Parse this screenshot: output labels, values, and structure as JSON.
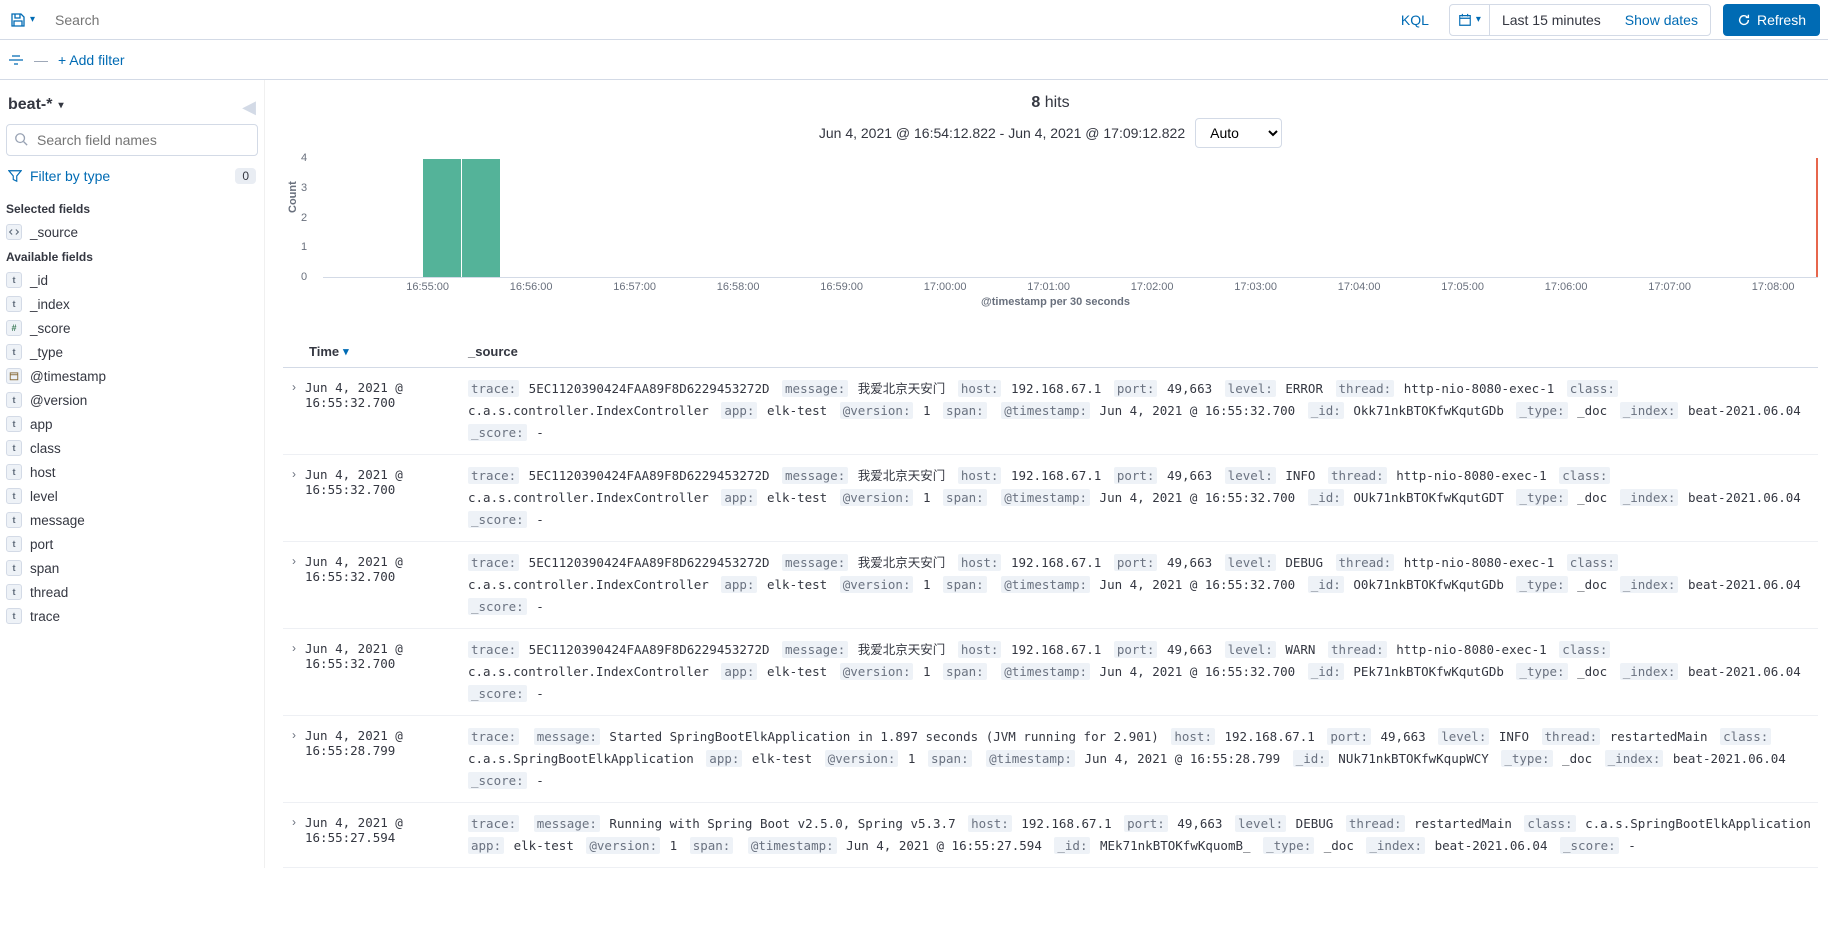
{
  "topbar": {
    "search_placeholder": "Search",
    "kql_label": "KQL",
    "date_text": "Last 15 minutes",
    "show_dates": "Show dates",
    "refresh": "Refresh"
  },
  "filterbar": {
    "add_filter": "+ Add filter"
  },
  "sidebar": {
    "index_pattern": "beat-*",
    "field_search_placeholder": "Search field names",
    "filter_by_type": "Filter by type",
    "filter_count": "0",
    "selected_label": "Selected fields",
    "selected_fields": [
      {
        "type": "src",
        "name": "_source"
      }
    ],
    "available_label": "Available fields",
    "available_fields": [
      {
        "type": "t",
        "name": "_id"
      },
      {
        "type": "t",
        "name": "_index"
      },
      {
        "type": "#",
        "name": "_score"
      },
      {
        "type": "t",
        "name": "_type"
      },
      {
        "type": "d",
        "name": "@timestamp"
      },
      {
        "type": "t",
        "name": "@version"
      },
      {
        "type": "t",
        "name": "app"
      },
      {
        "type": "t",
        "name": "class"
      },
      {
        "type": "t",
        "name": "host"
      },
      {
        "type": "t",
        "name": "level"
      },
      {
        "type": "t",
        "name": "message"
      },
      {
        "type": "t",
        "name": "port"
      },
      {
        "type": "t",
        "name": "span"
      },
      {
        "type": "t",
        "name": "thread"
      },
      {
        "type": "t",
        "name": "trace"
      }
    ]
  },
  "content": {
    "hits_count": "8",
    "hits_label": "hits",
    "time_range": "Jun 4, 2021 @ 16:54:12.822 - Jun 4, 2021 @ 17:09:12.822",
    "interval": "Auto",
    "y_axis_label": "Count",
    "x_axis_label": "@timestamp per 30 seconds",
    "table_headers": {
      "time": "Time",
      "source": "_source"
    }
  },
  "chart_data": {
    "type": "bar",
    "categories": [
      "16:55:00",
      "16:55:30"
    ],
    "values": [
      4,
      4
    ],
    "ylim": [
      0,
      4
    ],
    "y_ticks": [
      0,
      1,
      2,
      3,
      4
    ],
    "x_ticks": [
      "16:55:00",
      "16:56:00",
      "16:57:00",
      "16:58:00",
      "16:59:00",
      "17:00:00",
      "17:01:00",
      "17:02:00",
      "17:03:00",
      "17:04:00",
      "17:05:00",
      "17:06:00",
      "17:07:00",
      "17:08:00"
    ],
    "xlabel": "@timestamp per 30 seconds",
    "ylabel": "Count"
  },
  "documents": [
    {
      "time": "Jun 4, 2021 @ 16:55:32.700",
      "fields": [
        {
          "k": "trace:",
          "v": "5EC1120390424FAA89F8D6229453272D"
        },
        {
          "k": "message:",
          "v": "我爱北京天安门"
        },
        {
          "k": "host:",
          "v": "192.168.67.1"
        },
        {
          "k": "port:",
          "v": "49,663"
        },
        {
          "k": "level:",
          "v": "ERROR"
        },
        {
          "k": "thread:",
          "v": "http-nio-8080-exec-1"
        },
        {
          "k": "class:",
          "v": "c.a.s.controller.IndexController"
        },
        {
          "k": "app:",
          "v": "elk-test"
        },
        {
          "k": "@version:",
          "v": "1"
        },
        {
          "k": "span:",
          "v": ""
        },
        {
          "k": "@timestamp:",
          "v": "Jun 4, 2021 @ 16:55:32.700"
        },
        {
          "k": "_id:",
          "v": "Okk71nkBTOKfwKqutGDb"
        },
        {
          "k": "_type:",
          "v": "_doc"
        },
        {
          "k": "_index:",
          "v": "beat-2021.06.04"
        },
        {
          "k": "_score:",
          "v": "-"
        }
      ]
    },
    {
      "time": "Jun 4, 2021 @ 16:55:32.700",
      "fields": [
        {
          "k": "trace:",
          "v": "5EC1120390424FAA89F8D6229453272D"
        },
        {
          "k": "message:",
          "v": "我爱北京天安门"
        },
        {
          "k": "host:",
          "v": "192.168.67.1"
        },
        {
          "k": "port:",
          "v": "49,663"
        },
        {
          "k": "level:",
          "v": "INFO"
        },
        {
          "k": "thread:",
          "v": "http-nio-8080-exec-1"
        },
        {
          "k": "class:",
          "v": "c.a.s.controller.IndexController"
        },
        {
          "k": "app:",
          "v": "elk-test"
        },
        {
          "k": "@version:",
          "v": "1"
        },
        {
          "k": "span:",
          "v": ""
        },
        {
          "k": "@timestamp:",
          "v": "Jun 4, 2021 @ 16:55:32.700"
        },
        {
          "k": "_id:",
          "v": "OUk71nkBTOKfwKqutGDT"
        },
        {
          "k": "_type:",
          "v": "_doc"
        },
        {
          "k": "_index:",
          "v": "beat-2021.06.04"
        },
        {
          "k": "_score:",
          "v": "-"
        }
      ]
    },
    {
      "time": "Jun 4, 2021 @ 16:55:32.700",
      "fields": [
        {
          "k": "trace:",
          "v": "5EC1120390424FAA89F8D6229453272D"
        },
        {
          "k": "message:",
          "v": "我爱北京天安门"
        },
        {
          "k": "host:",
          "v": "192.168.67.1"
        },
        {
          "k": "port:",
          "v": "49,663"
        },
        {
          "k": "level:",
          "v": "DEBUG"
        },
        {
          "k": "thread:",
          "v": "http-nio-8080-exec-1"
        },
        {
          "k": "class:",
          "v": "c.a.s.controller.IndexController"
        },
        {
          "k": "app:",
          "v": "elk-test"
        },
        {
          "k": "@version:",
          "v": "1"
        },
        {
          "k": "span:",
          "v": ""
        },
        {
          "k": "@timestamp:",
          "v": "Jun 4, 2021 @ 16:55:32.700"
        },
        {
          "k": "_id:",
          "v": "O0k71nkBTOKfwKqutGDb"
        },
        {
          "k": "_type:",
          "v": "_doc"
        },
        {
          "k": "_index:",
          "v": "beat-2021.06.04"
        },
        {
          "k": "_score:",
          "v": "-"
        }
      ]
    },
    {
      "time": "Jun 4, 2021 @ 16:55:32.700",
      "fields": [
        {
          "k": "trace:",
          "v": "5EC1120390424FAA89F8D6229453272D"
        },
        {
          "k": "message:",
          "v": "我爱北京天安门"
        },
        {
          "k": "host:",
          "v": "192.168.67.1"
        },
        {
          "k": "port:",
          "v": "49,663"
        },
        {
          "k": "level:",
          "v": "WARN"
        },
        {
          "k": "thread:",
          "v": "http-nio-8080-exec-1"
        },
        {
          "k": "class:",
          "v": "c.a.s.controller.IndexController"
        },
        {
          "k": "app:",
          "v": "elk-test"
        },
        {
          "k": "@version:",
          "v": "1"
        },
        {
          "k": "span:",
          "v": ""
        },
        {
          "k": "@timestamp:",
          "v": "Jun 4, 2021 @ 16:55:32.700"
        },
        {
          "k": "_id:",
          "v": "PEk71nkBTOKfwKqutGDb"
        },
        {
          "k": "_type:",
          "v": "_doc"
        },
        {
          "k": "_index:",
          "v": "beat-2021.06.04"
        },
        {
          "k": "_score:",
          "v": "-"
        }
      ]
    },
    {
      "time": "Jun 4, 2021 @ 16:55:28.799",
      "fields": [
        {
          "k": "trace:",
          "v": ""
        },
        {
          "k": "message:",
          "v": "Started SpringBootElkApplication in 1.897 seconds (JVM running for 2.901)"
        },
        {
          "k": "host:",
          "v": "192.168.67.1"
        },
        {
          "k": "port:",
          "v": "49,663"
        },
        {
          "k": "level:",
          "v": "INFO"
        },
        {
          "k": "thread:",
          "v": "restartedMain"
        },
        {
          "k": "class:",
          "v": "c.a.s.SpringBootElkApplication"
        },
        {
          "k": "app:",
          "v": "elk-test"
        },
        {
          "k": "@version:",
          "v": "1"
        },
        {
          "k": "span:",
          "v": ""
        },
        {
          "k": "@timestamp:",
          "v": "Jun 4, 2021 @ 16:55:28.799"
        },
        {
          "k": "_id:",
          "v": "NUk71nkBTOKfwKqupWCY"
        },
        {
          "k": "_type:",
          "v": "_doc"
        },
        {
          "k": "_index:",
          "v": "beat-2021.06.04"
        },
        {
          "k": "_score:",
          "v": "-"
        }
      ]
    },
    {
      "time": "Jun 4, 2021 @ 16:55:27.594",
      "fields": [
        {
          "k": "trace:",
          "v": ""
        },
        {
          "k": "message:",
          "v": "Running with Spring Boot v2.5.0, Spring v5.3.7"
        },
        {
          "k": "host:",
          "v": "192.168.67.1"
        },
        {
          "k": "port:",
          "v": "49,663"
        },
        {
          "k": "level:",
          "v": "DEBUG"
        },
        {
          "k": "thread:",
          "v": "restartedMain"
        },
        {
          "k": "class:",
          "v": "c.a.s.SpringBootElkApplication"
        },
        {
          "k": "app:",
          "v": "elk-test"
        },
        {
          "k": "@version:",
          "v": "1"
        },
        {
          "k": "span:",
          "v": ""
        },
        {
          "k": "@timestamp:",
          "v": "Jun 4, 2021 @ 16:55:27.594"
        },
        {
          "k": "_id:",
          "v": "MEk71nkBTOKfwKquomB_"
        },
        {
          "k": "_type:",
          "v": "_doc"
        },
        {
          "k": "_index:",
          "v": "beat-2021.06.04"
        },
        {
          "k": "_score:",
          "v": "-"
        }
      ]
    }
  ]
}
